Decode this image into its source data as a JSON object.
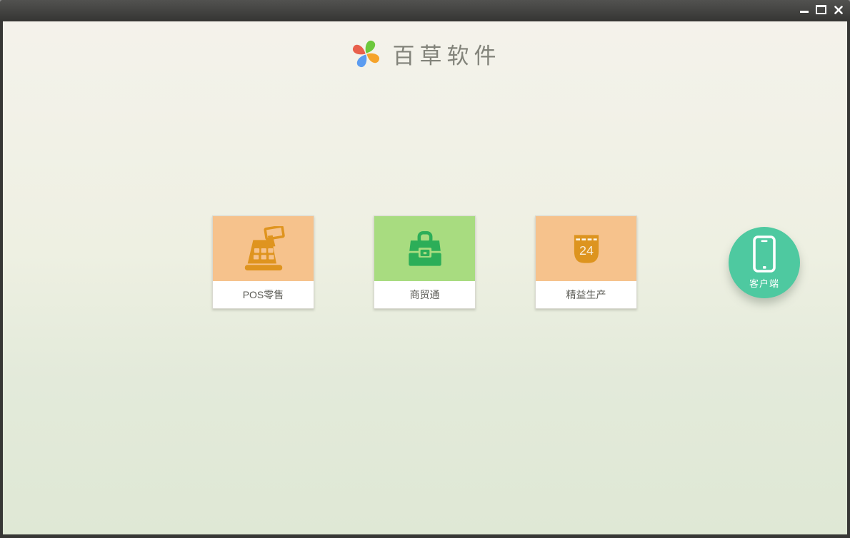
{
  "window": {
    "title_bar": {
      "controls": [
        {
          "name": "minimize"
        },
        {
          "name": "maximize"
        },
        {
          "name": "close"
        }
      ],
      "bar_color_top": "#525250",
      "bar_color_bottom": "#353533"
    },
    "frame_color": "#373735"
  },
  "brand": {
    "name": "百草软件",
    "logo_colors": {
      "top": "#6cc83c",
      "right": "#f5a32a",
      "bottom": "#5b9cf0",
      "left": "#e8604c"
    }
  },
  "products": [
    {
      "label": "POS零售",
      "icon": "cash-register-icon",
      "tile_color": "#f6c28c",
      "icon_color": "#df941f"
    },
    {
      "label": "商贸通",
      "icon": "briefcase-icon",
      "tile_color": "#a8dc80",
      "icon_color": "#2cae58"
    },
    {
      "label": "精益生产",
      "icon": "calendar-icon",
      "badge": "24",
      "tile_color": "#f6c28c",
      "icon_color": "#dd941f"
    }
  ],
  "client": {
    "label": "客户端",
    "icon": "smartphone-icon",
    "color": "#4ec9a0"
  },
  "background": {
    "top": "#f4f2eb",
    "bottom": "#dfe8d5"
  }
}
